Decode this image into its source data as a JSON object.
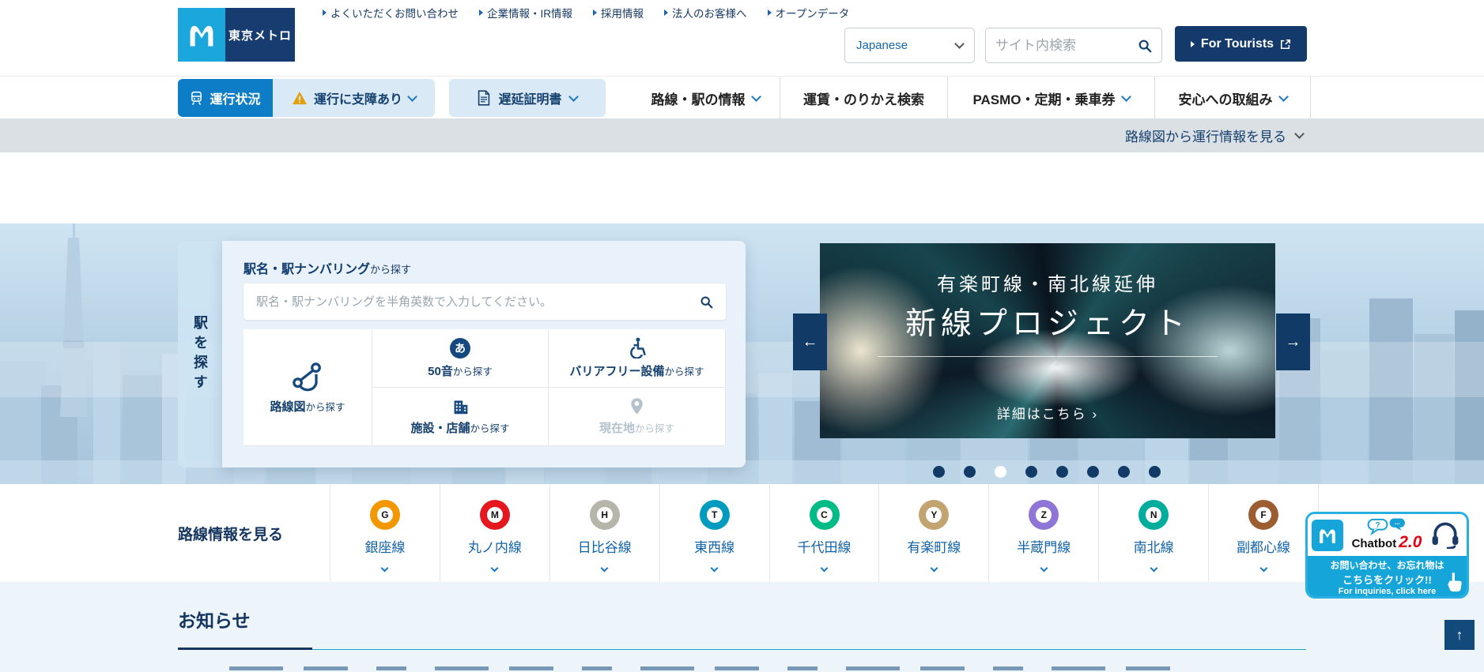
{
  "header": {
    "logo": {
      "brand_text": "東京メトロ"
    },
    "utility_links": [
      {
        "label": "よくいただくお問い合わせ"
      },
      {
        "label": "企業情報・IR情報"
      },
      {
        "label": "採用情報"
      },
      {
        "label": "法人のお客様へ"
      },
      {
        "label": "オープンデータ"
      }
    ],
    "language_select": {
      "value": "Japanese"
    },
    "site_search": {
      "placeholder": "サイト内検索"
    },
    "tourists_button": {
      "label": "For Tourists"
    }
  },
  "main_nav": {
    "status_button": "運行状況",
    "disruption_button": "運行に支障あり",
    "delay_certificate_button": "遅延証明書",
    "items": [
      {
        "label": "路線・駅の情報",
        "chevron": true
      },
      {
        "label": "運賃・のりかえ検索",
        "chevron": false
      },
      {
        "label": "PASMO・定期・乗車券",
        "chevron": true
      },
      {
        "label": "安心への取組み",
        "chevron": true
      }
    ]
  },
  "status_bar": {
    "link_label": "路線図から運行情報を見る"
  },
  "hero": {
    "vertical_tab": "駅を探す",
    "station_card": {
      "title_strong": "駅名・駅ナンバリング",
      "title_suffix": "から探す",
      "input_placeholder": "駅名・駅ナンバリングを半角英数で入力してください。",
      "options": [
        {
          "strong": "路線図",
          "suffix": "から探す"
        },
        {
          "strong": "50音",
          "suffix": "から探す",
          "badge_char": "あ"
        },
        {
          "strong": "バリアフリー設備",
          "suffix": "から探す"
        },
        {
          "strong": "施設・店舗",
          "suffix": "から探す"
        },
        {
          "strong": "現在地",
          "suffix": "から探す"
        }
      ]
    },
    "carousel": {
      "slide_title_line1": "有楽町線・南北線延伸",
      "slide_title_line2": "新線プロジェクト",
      "slide_cta": "詳細はこちら",
      "slide_cta_arrow": "›",
      "prev_arrow": "←",
      "next_arrow": "→",
      "dot_count": 8,
      "active_dot_index": 2
    }
  },
  "lines_section": {
    "label": "路線情報を見る",
    "items": [
      {
        "symbol": "G",
        "name": "銀座線",
        "color": "#f39700"
      },
      {
        "symbol": "M",
        "name": "丸ノ内線",
        "color": "#e5171f"
      },
      {
        "symbol": "H",
        "name": "日比谷線",
        "color": "#b5b5ac"
      },
      {
        "symbol": "T",
        "name": "東西線",
        "color": "#009bbf"
      },
      {
        "symbol": "C",
        "name": "千代田線",
        "color": "#00bb85"
      },
      {
        "symbol": "Y",
        "name": "有楽町線",
        "color": "#c1a470"
      },
      {
        "symbol": "Z",
        "name": "半蔵門線",
        "color": "#8f76d6"
      },
      {
        "symbol": "N",
        "name": "南北線",
        "color": "#00ac9b"
      },
      {
        "symbol": "F",
        "name": "副都心線",
        "color": "#9c5e31"
      }
    ]
  },
  "chatbot": {
    "brand": "Chatbot",
    "version": "2.0",
    "line1": "お問い合わせ、お忘れ物は",
    "line2": "こちらをクリック!!",
    "line3": "For inquiries, click here"
  },
  "news": {
    "heading": "お知らせ"
  },
  "scroll_top": {
    "arrow": "↑"
  },
  "colors": {
    "brand_light_blue": "#1ba7dc",
    "brand_navy": "#173c70",
    "nav_active_blue": "#0e7dc7",
    "nav_pill_bg": "#d9e9f6",
    "warning_amber": "#e2a00d",
    "status_bar_gray": "#dbe0e4",
    "chatbot_cyan": "#15a5d9",
    "chatbot_red": "#e60012",
    "news_rule_teal": "#19a8c8"
  }
}
